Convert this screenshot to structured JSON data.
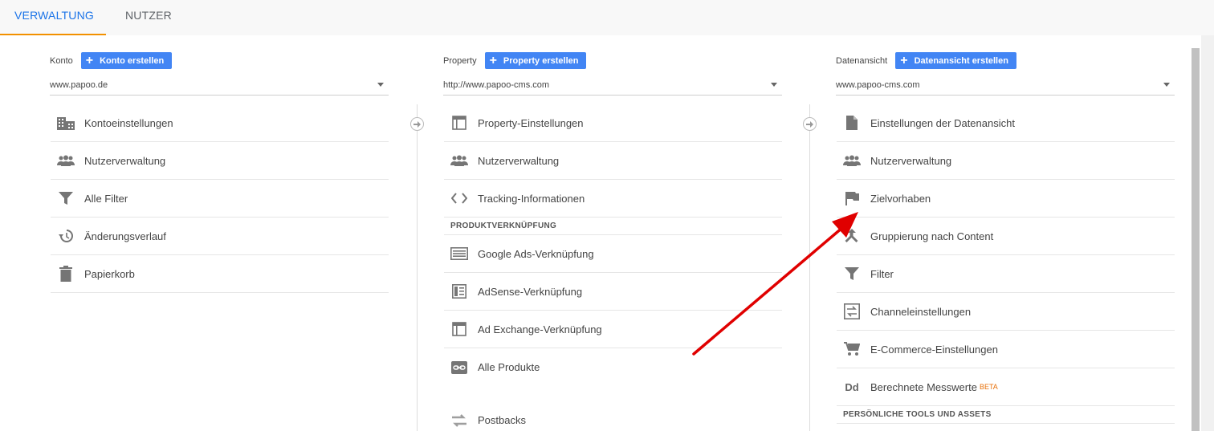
{
  "tabs": {
    "admin": "VERWALTUNG",
    "users": "NUTZER"
  },
  "accent_colors": {
    "tab_active": "#1a73e8",
    "tab_underline": "#f29100",
    "button": "#4285f4",
    "arrow": "#e00000"
  },
  "account": {
    "label": "Konto",
    "create": "Konto erstellen",
    "selected": "www.papoo.de",
    "items": [
      {
        "label": "Kontoeinstellungen",
        "icon": "building-icon"
      },
      {
        "label": "Nutzerverwaltung",
        "icon": "people-icon"
      },
      {
        "label": "Alle Filter",
        "icon": "filter-icon"
      },
      {
        "label": "Änderungsverlauf",
        "icon": "history-icon"
      },
      {
        "label": "Papierkorb",
        "icon": "trash-icon"
      }
    ]
  },
  "property": {
    "label": "Property",
    "create": "Property erstellen",
    "selected": "http://www.papoo-cms.com",
    "items": [
      {
        "label": "Property-Einstellungen",
        "icon": "window-icon"
      },
      {
        "label": "Nutzerverwaltung",
        "icon": "people-icon"
      },
      {
        "label": "Tracking-Informationen",
        "icon": "code-icon"
      }
    ],
    "section": "PRODUKTVERKNÜPFUNG",
    "links": [
      {
        "label": "Google Ads-Verknüpfung",
        "icon": "ads-icon"
      },
      {
        "label": "AdSense-Verknüpfung",
        "icon": "adsense-icon"
      },
      {
        "label": "Ad Exchange-Verknüpfung",
        "icon": "window-icon"
      },
      {
        "label": "Alle Produkte",
        "icon": "link-icon"
      }
    ],
    "extra": {
      "label": "Postbacks",
      "icon": "postback-icon"
    }
  },
  "view": {
    "label": "Datenansicht",
    "create": "Datenansicht erstellen",
    "selected": "www.papoo-cms.com",
    "items": [
      {
        "label": "Einstellungen der Datenansicht",
        "icon": "document-icon"
      },
      {
        "label": "Nutzerverwaltung",
        "icon": "people-icon"
      },
      {
        "label": "Zielvorhaben",
        "icon": "flag-icon"
      },
      {
        "label": "Gruppierung nach Content",
        "icon": "merge-icon"
      },
      {
        "label": "Filter",
        "icon": "filter-icon"
      },
      {
        "label": "Channeleinstellungen",
        "icon": "channel-icon"
      },
      {
        "label": "E-Commerce-Einstellungen",
        "icon": "cart-icon"
      },
      {
        "label": "Berechnete Messwerte",
        "icon": "dd-icon",
        "badge": "BETA",
        "icon_text": "Dd"
      }
    ],
    "section": "PERSÖNLICHE TOOLS UND ASSETS"
  }
}
